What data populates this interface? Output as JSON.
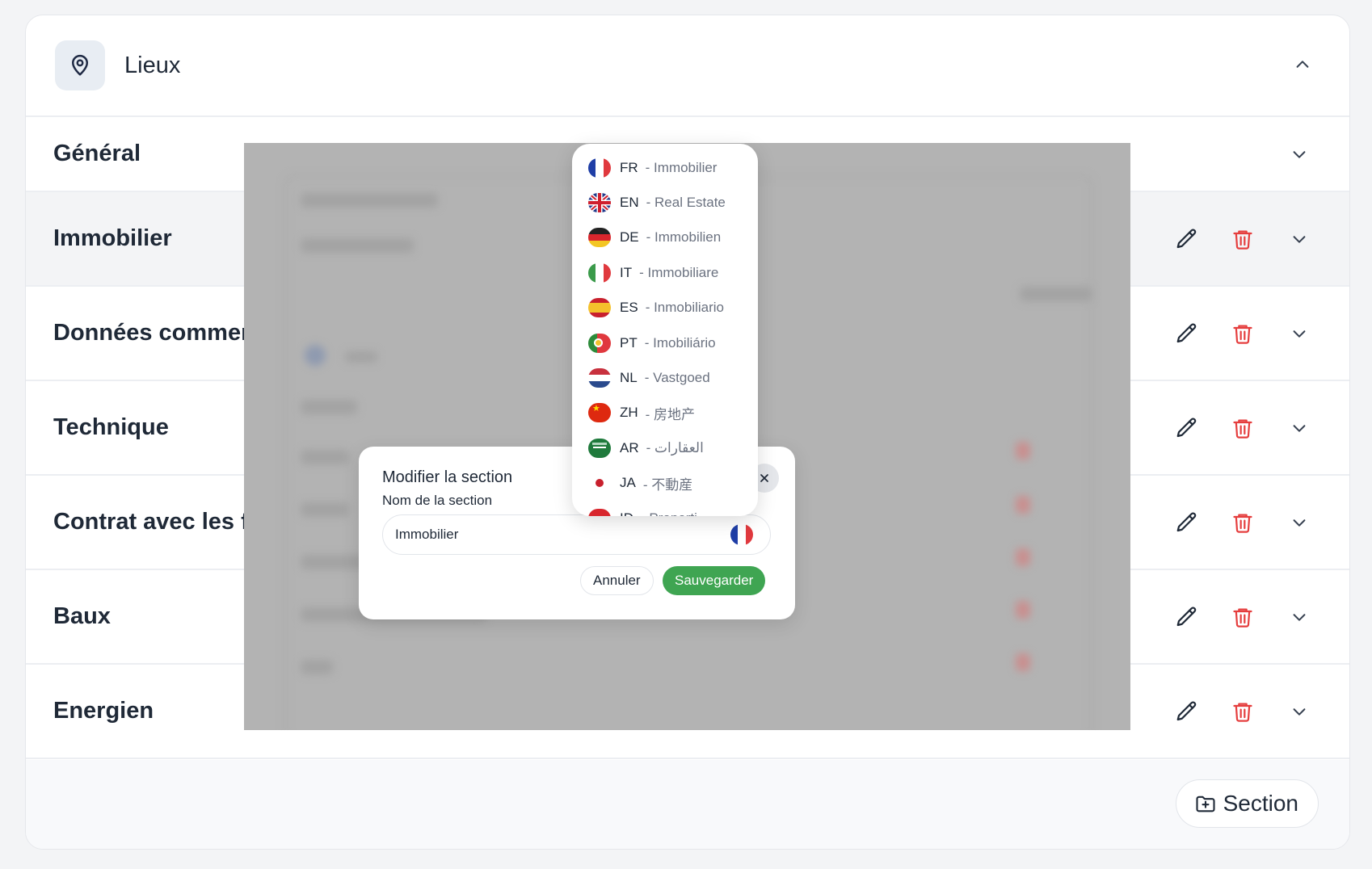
{
  "panel": {
    "title": "Lieux",
    "sections": [
      {
        "label": "Général",
        "actions": false
      },
      {
        "label": "Immobilier",
        "actions": true
      },
      {
        "label": "Données commerc",
        "actions": true
      },
      {
        "label": "Technique",
        "actions": true
      },
      {
        "label": "Contrat avec les fo",
        "actions": true
      },
      {
        "label": "Baux",
        "actions": true
      },
      {
        "label": "Energien",
        "actions": true
      }
    ],
    "add_section_label": "Section"
  },
  "modal": {
    "title": "Modifier la section",
    "field_label": "Nom de la section",
    "field_value": "Immobilier",
    "cancel_label": "Annuler",
    "save_label": "Sauvegarder"
  },
  "language_dropdown": {
    "items": [
      {
        "code": "FR",
        "name": "- Immobilier",
        "flag": "fr"
      },
      {
        "code": "EN",
        "name": "- Real Estate",
        "flag": "gb"
      },
      {
        "code": "DE",
        "name": "- Immobilien",
        "flag": "de"
      },
      {
        "code": "IT",
        "name": "- Immobiliare",
        "flag": "it"
      },
      {
        "code": "ES",
        "name": "- Inmobiliario",
        "flag": "es"
      },
      {
        "code": "PT",
        "name": "- Imobiliário",
        "flag": "pt"
      },
      {
        "code": "NL",
        "name": "- Vastgoed",
        "flag": "nl"
      },
      {
        "code": "ZH",
        "name": "- 房地产",
        "flag": "cn"
      },
      {
        "code": "AR",
        "name": "- العقارات",
        "flag": "sa"
      },
      {
        "code": "JA",
        "name": "- 不動産",
        "flag": "jp"
      },
      {
        "code": "ID",
        "name": "- Properti",
        "flag": "id"
      }
    ]
  },
  "colors": {
    "accent_green": "#3fa552",
    "danger_red": "#e53e3e",
    "text_dark": "#1f2937",
    "text_muted": "#6b7280"
  }
}
